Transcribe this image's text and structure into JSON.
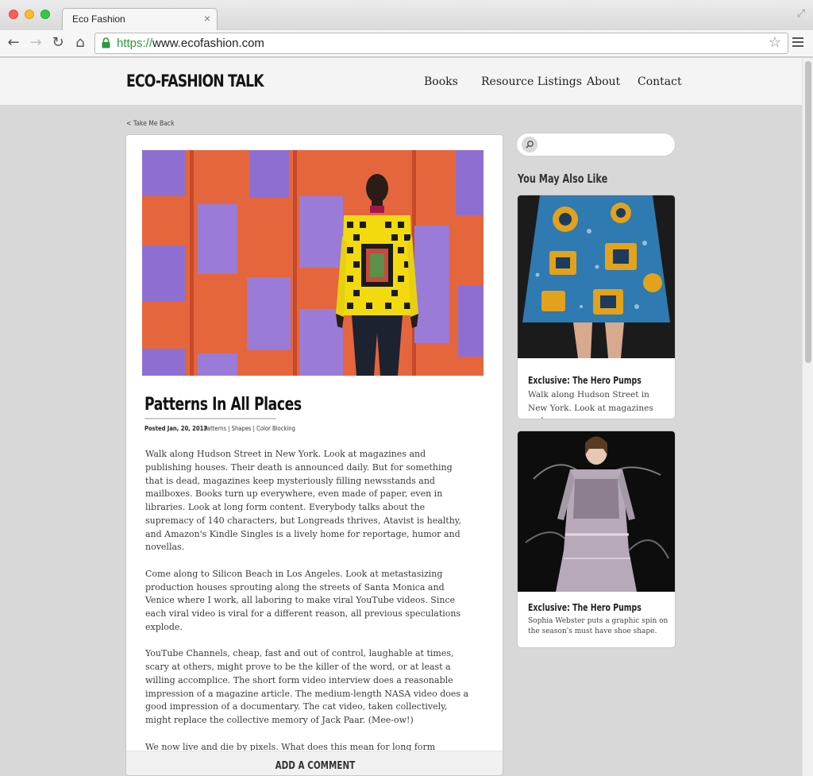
{
  "browser": {
    "tab_title": "Eco Fashion",
    "tab_close": "×",
    "url_scheme": "https://",
    "url_rest": "www.ecofashion.com"
  },
  "site": {
    "logo": "ECO-FASHION TALK",
    "nav": [
      "Books",
      "Resource Listings",
      "About",
      "Contact"
    ]
  },
  "back_link": "< Take Me Back",
  "article": {
    "title": "Patterns In All Places",
    "posted": "Posted Jan, 20, 2013",
    "tags": [
      "Patterns",
      "Shapes",
      "Color Blocking"
    ],
    "tag_separator": " | ",
    "paragraphs": [
      "Walk along Hudson Street in New York. Look at magazines and publishing houses. Their death is announced daily. But for something that is dead, magazines keep mysteriously filling newsstands and mailboxes. Books turn up everywhere, even made of paper, even in libraries. Look at long form content. Everybody talks about the supremacy of 140 characters, but Longreads thrives, Atavist is healthy, and Amazon's Kindle Singles is a lively home for reportage, humor and novellas.",
      "Come along to Silicon Beach in Los Angeles. Look at metastasizing production houses sprouting along the streets of Santa Monica and Venice where I work, all laboring to make viral YouTube videos. Since each viral video is viral for a different reason, all previous speculations explode.",
      "YouTube Channels, cheap, fast and out of control, laughable at times, scary at others, might prove to be the killer of the word, or at least a willing accomplice. The short form video interview does a reasonable impression of a magazine article. The medium-length NASA video does a good impression of a documentary. The cat video, taken collectively, might replace the collective memory of Jack Paar. (Mee-ow!)",
      "We now live and die by pixels. What does this mean for long form writing? Bora Zivkovic, blogs editor at Scientific American, visiting scholar at NYU school of journalism and co-founder of Science Online, responded this way when I emailed him with that question:"
    ],
    "add_comment": "ADD A COMMENT"
  },
  "sidebar": {
    "search_placeholder": "",
    "heading": "You May Also Like",
    "cards": [
      {
        "title": "Exclusive: The Hero Pumps",
        "excerpt": "Walk along Hudson Street in New York. Look at magazines and"
      },
      {
        "title": "Exclusive: The Hero Pumps",
        "excerpt": "Sophia Webster puts a graphic spin on the season's must have shoe shape."
      }
    ]
  }
}
